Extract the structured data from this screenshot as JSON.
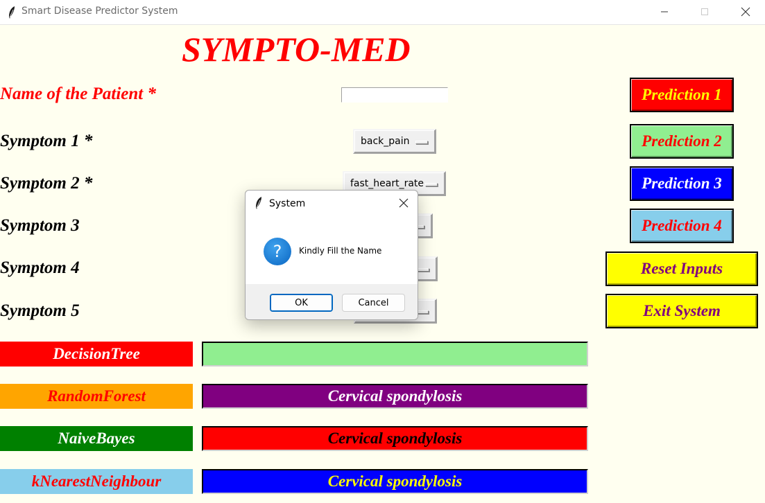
{
  "window": {
    "title": "Smart Disease Predictor System",
    "app_icon": "feather-icon",
    "controls": [
      "minimize-icon",
      "maximize-icon",
      "close-icon"
    ]
  },
  "app": {
    "heading": "SYMPTO-MED",
    "labels": {
      "name": "Name of the Patient *",
      "symptom1": "Symptom 1 *",
      "symptom2": "Symptom 2 *",
      "symptom3": "Symptom 3",
      "symptom4": "Symptom 4",
      "symptom5": "Symptom 5"
    },
    "name_value": "",
    "symptom_values": {
      "symptom1": "back_pain",
      "symptom2": "fast_heart_rate",
      "symptom3": "",
      "symptom4": "",
      "symptom5": ""
    },
    "buttons": {
      "prediction1": "Prediction 1",
      "prediction2": "Prediction 2",
      "prediction3": "Prediction 3",
      "prediction4": "Prediction 4",
      "reset": "Reset Inputs",
      "exit": "Exit System"
    },
    "algorithms": {
      "decision_tree": "DecisionTree",
      "random_forest": "RandomForest",
      "naive_bayes": "NaiveBayes",
      "knn": "kNearestNeighbour"
    },
    "results": {
      "decision_tree": "",
      "random_forest": "Cervical spondylosis",
      "naive_bayes": "Cervical spondylosis",
      "knn": "Cervical spondylosis"
    },
    "colors": {
      "background": "#fffff0",
      "heading": "#ff0000",
      "prediction1_bg": "#ff0000",
      "prediction1_fg": "#ffff00",
      "prediction2_bg": "#90ee90",
      "prediction2_fg": "#ff0000",
      "prediction3_bg": "#0000ff",
      "prediction3_fg": "#ffffff",
      "prediction4_bg": "#87ceeb",
      "prediction4_fg": "#ff0000",
      "reset_bg": "#ffff00",
      "reset_fg": "#800080",
      "exit_bg": "#ffff00",
      "exit_fg": "#800080"
    }
  },
  "dialog": {
    "title": "System",
    "message": "Kindly Fill the Name",
    "icon": "question-icon",
    "ok_label": "OK",
    "cancel_label": "Cancel"
  }
}
